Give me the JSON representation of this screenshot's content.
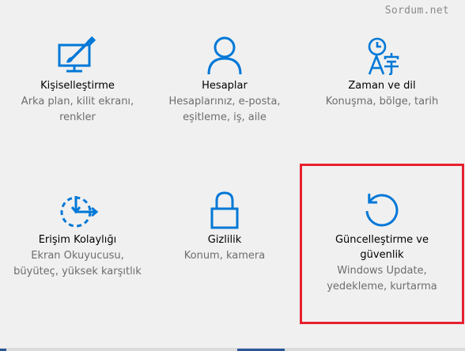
{
  "watermark": "Sordum.net",
  "colors": {
    "accent": "#0078d7",
    "highlight": "#e8202f",
    "background": "#f0f0f0"
  },
  "tiles": [
    {
      "icon": "personalization-icon",
      "title": "Kişiselleştirme",
      "desc_line1": "Arka plan, kilit ekranı,",
      "desc_line2": "renkler"
    },
    {
      "icon": "accounts-icon",
      "title": "Hesaplar",
      "desc_line1": "Hesaplarınız, e-posta,",
      "desc_line2": "eşitleme, iş, aile"
    },
    {
      "icon": "time-language-icon",
      "title": "Zaman ve dil",
      "desc_line1": "Konuşma, bölge, tarih",
      "desc_line2": ""
    },
    {
      "icon": "ease-of-access-icon",
      "title": "Erişim Kolaylığı",
      "desc_line1": "Ekran Okuyucusu,",
      "desc_line2": "büyüteç, yüksek karşıtlık"
    },
    {
      "icon": "privacy-lock-icon",
      "title": "Gizlilik",
      "desc_line1": "Konum, kamera",
      "desc_line2": ""
    },
    {
      "icon": "update-security-icon",
      "title_line1": "Güncelleştirme ve",
      "title_line2": "güvenlik",
      "desc_line1": "Windows Update,",
      "desc_line2": "yedekleme, kurtarma"
    }
  ]
}
